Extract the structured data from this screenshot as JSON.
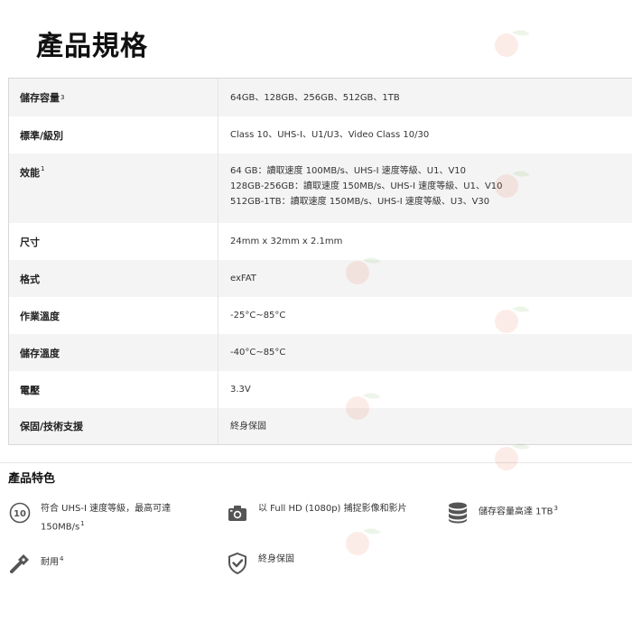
{
  "page_title": "產品規格",
  "specs": [
    {
      "label": "儲存容量",
      "sup": "3",
      "lines": [
        "64GB、128GB、256GB、512GB、1TB"
      ]
    },
    {
      "label": "標準/級別",
      "sup": "",
      "lines": [
        "Class 10、UHS-I、U1/U3、Video Class 10/30"
      ]
    },
    {
      "label": "效能",
      "sup": "1",
      "lines": [
        "64 GB：讀取速度 100MB/s、UHS-I 速度等級、U1、V10",
        "128GB-256GB：讀取速度 150MB/s、UHS-I 速度等級、U1、V10",
        "512GB-1TB：讀取速度 150MB/s、UHS-I 速度等級、U3、V30"
      ]
    },
    {
      "label": "尺寸",
      "sup": "",
      "lines": [
        "24mm x 32mm x 2.1mm"
      ]
    },
    {
      "label": "格式",
      "sup": "",
      "lines": [
        "exFAT"
      ]
    },
    {
      "label": "作業溫度",
      "sup": "",
      "lines": [
        "-25°C~85°C"
      ]
    },
    {
      "label": "儲存溫度",
      "sup": "",
      "lines": [
        "-40°C~85°C"
      ]
    },
    {
      "label": "電壓",
      "sup": "",
      "lines": [
        "3.3V"
      ]
    },
    {
      "label": "保固/技術支援",
      "sup": "",
      "lines": [
        "終身保固"
      ]
    }
  ],
  "features_title": "產品特色",
  "features": [
    {
      "icon": "speed-class-10-icon",
      "line1": "符合 UHS-I 速度等級，最高可達",
      "line2": "150MB/s",
      "sup": "1",
      "icon_text": "10"
    },
    {
      "icon": "camera-icon",
      "line1": "以 Full HD (1080p) 捕捉影像和影片",
      "line2": "",
      "sup": ""
    },
    {
      "icon": "storage-database-icon",
      "line1": "儲存容量高達 1TB",
      "line2": "",
      "sup": "3"
    },
    {
      "icon": "wrench-tool-icon",
      "line1": "耐用",
      "line2": "",
      "sup": "4"
    },
    {
      "icon": "shield-check-icon",
      "line1": "終身保固",
      "line2": "",
      "sup": ""
    }
  ],
  "colors": {
    "icon": "#555555",
    "row_alt": "#f4f4f4",
    "border": "#d8d8d8",
    "watermark": "#e8501e"
  }
}
